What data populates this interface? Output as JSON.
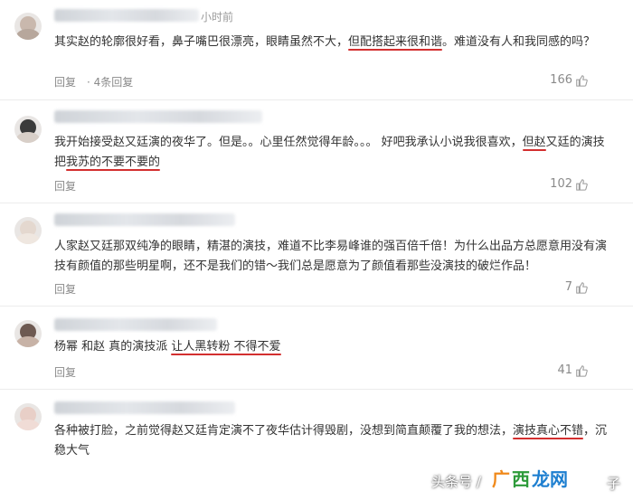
{
  "comments": [
    {
      "time": "小时前",
      "text_segments": [
        {
          "t": "其实赵的轮廓很好看，鼻子嘴巴很漂亮，眼睛虽然不大，",
          "hl": false
        },
        {
          "t": "但配搭起来很和谐",
          "hl": true
        },
        {
          "t": "。难道没有人和我同感的吗？",
          "hl": false
        }
      ],
      "reply_label": "回复",
      "reply_count": "· 4条回复",
      "likes": "166"
    },
    {
      "time": "",
      "text_segments": [
        {
          "t": "我开始接受赵又廷演的夜华了。但是。。心里任然觉得年龄。。。  好吧我承认小说我很喜欢，",
          "hl": false
        },
        {
          "t": "但赵",
          "hl": true
        },
        {
          "t": "又廷的演技把",
          "hl": false
        },
        {
          "t": "我苏的不要不要的",
          "hl": true
        }
      ],
      "reply_label": "回复",
      "reply_count": "",
      "likes": "102"
    },
    {
      "time": "",
      "text_segments": [
        {
          "t": "人家赵又廷那双纯净的眼睛，精湛的演技，难道不比李易峰谁的强百倍千倍！为什么出品方总愿意用没有演技有颜值的那些明星啊，还不是我们的错～我们总是愿意为了颜值看那些没演技的破烂作品！",
          "hl": false
        }
      ],
      "reply_label": "回复",
      "reply_count": "",
      "likes": "7"
    },
    {
      "time": "",
      "text_segments": [
        {
          "t": "杨幂 和赵 真的演技派 ",
          "hl": false
        },
        {
          "t": "让人黑转粉 不得不爱",
          "hl": true
        }
      ],
      "reply_label": "回复",
      "reply_count": "",
      "likes": "41"
    },
    {
      "time": "",
      "text_segments": [
        {
          "t": "各种被打脸，之前觉得赵又廷肯定演不了夜华估计得毁剧，没想到简直颠覆了我的想法，",
          "hl": false
        },
        {
          "t": "演技真心不错",
          "hl": true
        },
        {
          "t": "，",
          "hl": false
        },
        {
          "t": "沉稳大气",
          "hl": true
        }
      ],
      "reply_label": "回复",
      "reply_count": "",
      "likes": ""
    }
  ],
  "watermark": {
    "prefix": "头条号 /",
    "logo_a": "广",
    "logo_b": "西",
    "logo_c": "龙网",
    "suffix": "子"
  }
}
